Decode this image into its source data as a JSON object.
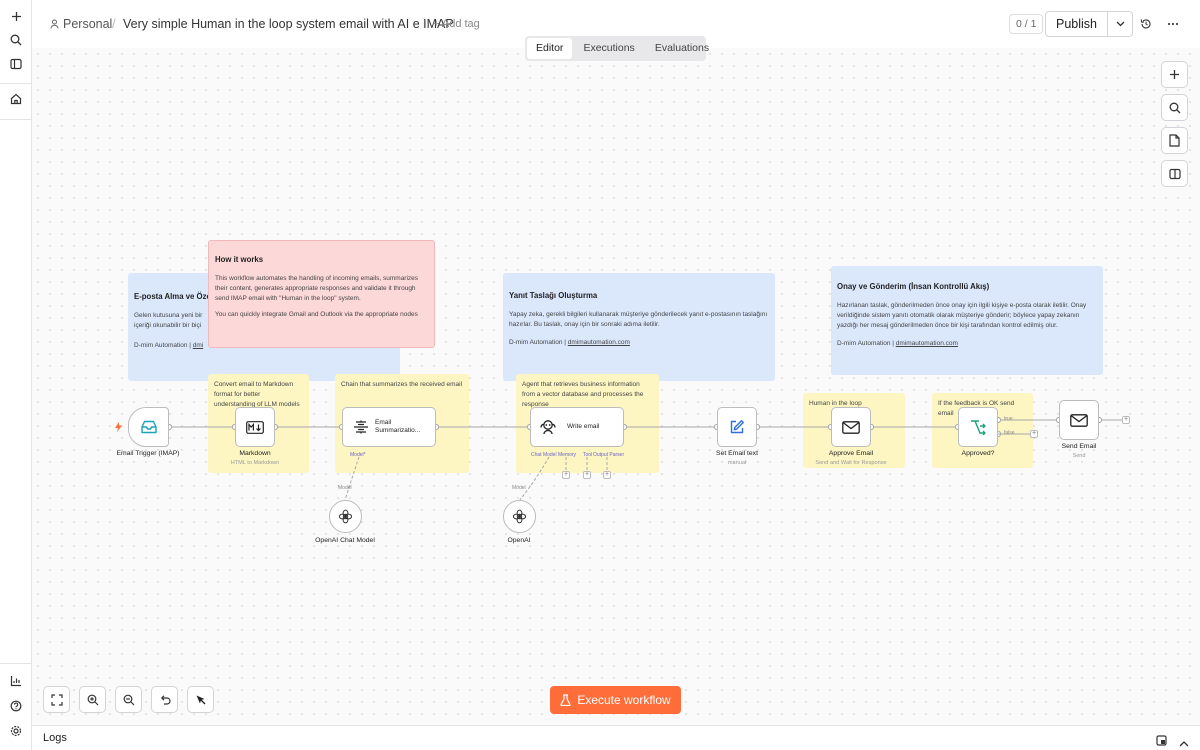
{
  "header": {
    "breadcrumb_personal": "Personal",
    "workflow_title": "Very simple Human in the loop system email with AI e IMAP",
    "add_tag": "+ Add tag",
    "version_counter": "0 / 1",
    "publish_label": "Publish"
  },
  "tabs": [
    {
      "label": "Editor",
      "active": true
    },
    {
      "label": "Executions",
      "active": false
    },
    {
      "label": "Evaluations",
      "active": false
    }
  ],
  "sticky_notes": {
    "email_receive": {
      "title": "E-posta Alma ve Öze",
      "line1": "Gelen kutusuna yeni bir",
      "line2": "içeriği okunabilir bir biçi",
      "footer_prefix": "D-mim Automation | ",
      "footer_link": "dmi"
    },
    "how_it_works": {
      "title": "How it works",
      "body": "This workflow automates the handling of incoming emails, summarizes their content, generates appropriate responses and validate it through send IMAP email with \"Human in the loop\" system.",
      "body2": "You can quickly integrate Gmail and Outlook via the appropriate nodes"
    },
    "reply_draft": {
      "title": "Yanıt Taslağı Oluşturma",
      "body": "Yapay zeka, gerekli bilgileri kullanarak müşteriye gönderilecek yanıt e-postasının taslağını hazırlar. Bu taslak, onay için bir sonraki adıma iletilir.",
      "footer_prefix": "D-mim Automation | ",
      "footer_link": "dmimautomation.com"
    },
    "approval": {
      "title": "Onay ve Gönderim (İnsan Kontrollü Akış)",
      "body": "Hazırlanan taslak, gönderilmeden önce onay için ilgili kişiye e-posta olarak iletilir. Onay verildiğinde sistem yanıtı otomatik olarak müşteriye gönderir; böylece yapay zekanın yazdığı her mesaj gönderilmeden önce bir kişi tarafından kontrol edilmiş olur.",
      "footer_prefix": "D-mim Automation | ",
      "footer_link": "dmimautomation.com"
    },
    "markdown_note": "Convert email to Markdown format for better understanding of LLM models",
    "summarize_note": "Chain that summarizes the received email",
    "agent_note": "Agent that retrieves business information from a vector database and processes the response",
    "hitl_note": "Human in the loop",
    "feedback_note": "If the feedback is OK send email"
  },
  "nodes": {
    "email_trigger": {
      "label": "Email Trigger (IMAP)"
    },
    "markdown": {
      "label": "Markdown",
      "sub": "HTML to Markdown"
    },
    "summarization": {
      "label": "Email Summarizatio...",
      "port_model": "Model*"
    },
    "write_email": {
      "label": "Write email",
      "port_chat": "Chat Model",
      "port_memory": "Memory",
      "port_tool": "Tool",
      "port_parser": "Output Parser"
    },
    "openai_chat": {
      "label": "OpenAI Chat Model",
      "edge_label": "Model"
    },
    "openai": {
      "label": "OpenAI",
      "edge_label": "Model"
    },
    "set_email_text": {
      "label": "Set Email text",
      "sub": "manual"
    },
    "approve_email": {
      "label": "Approve Email",
      "sub": "Send and Wait for Response"
    },
    "approved": {
      "label": "Approved?",
      "true_label": "true",
      "false_label": "false"
    },
    "send_email": {
      "label": "Send Email",
      "sub": "Send"
    }
  },
  "execute_button": "Execute workflow",
  "footer": {
    "logs_label": "Logs"
  },
  "colors": {
    "accent": "#ff6d3a",
    "sticky_blue": "#dbe8fc",
    "sticky_red": "#fcd8d8",
    "sticky_yellow": "#fdf6c3",
    "port_purple": "#6a66c8"
  }
}
